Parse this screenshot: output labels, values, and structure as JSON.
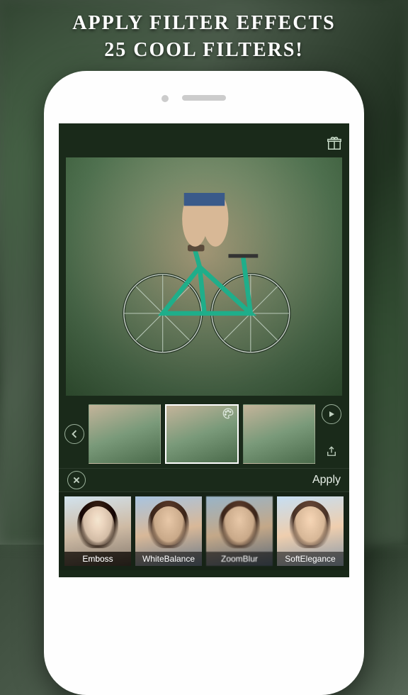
{
  "headline": {
    "line1": "APPLY FILTER EFFECTS",
    "line2": "25 COOL FILTERS!"
  },
  "topbar": {
    "gift_icon": "gift"
  },
  "thumbs": {
    "back_icon": "chevron-left",
    "palette_icon": "palette",
    "play_icon": "play",
    "share_icon": "share"
  },
  "actions": {
    "close_icon": "close",
    "apply_label": "Apply"
  },
  "filters": [
    {
      "name": "Emboss"
    },
    {
      "name": "WhiteBalance"
    },
    {
      "name": "ZoomBlur"
    },
    {
      "name": "SoftElegance"
    }
  ]
}
